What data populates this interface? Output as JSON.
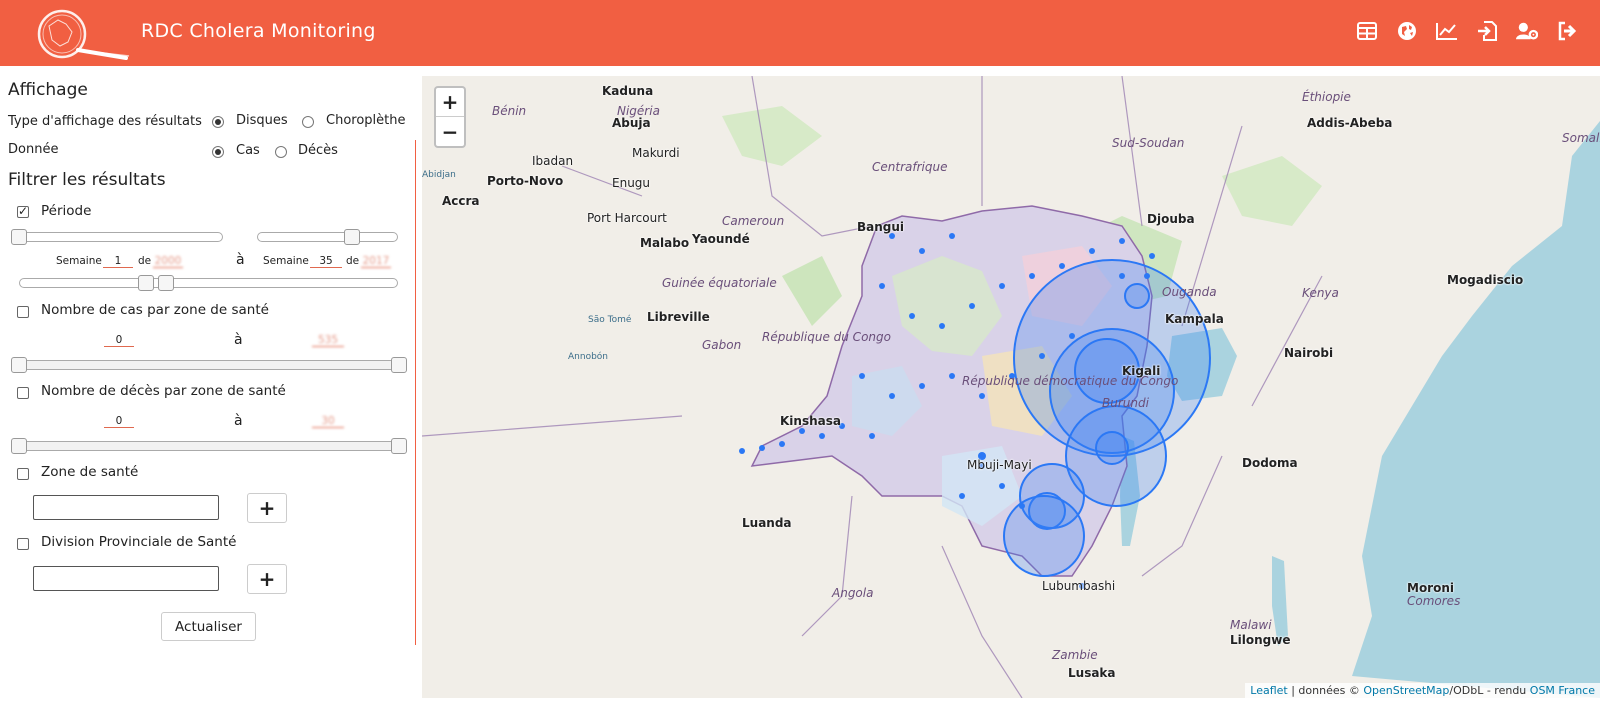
{
  "header": {
    "title": "RDC Cholera Monitoring",
    "icons": [
      "table-icon",
      "globe-icon",
      "chart-line-icon",
      "file-import-icon",
      "user-cog-icon",
      "sign-out-icon"
    ],
    "background": "#f15f42"
  },
  "sidebar": {
    "display_title": "Affichage",
    "display_type_label": "Type d'affichage des résultats",
    "display_type_options": [
      "Disques",
      "Choroplèthe"
    ],
    "display_type_selected": "Disques",
    "data_label": "Donnée",
    "data_options": [
      "Cas",
      "Décès"
    ],
    "data_selected": "Cas",
    "filter_title": "Filtrer les résultats",
    "period": {
      "label": "Période",
      "checked": true,
      "week_label": "Semaine",
      "of_label": "de",
      "to_label": "à",
      "start_week": "1",
      "start_year": "2000",
      "end_week": "35",
      "end_year": "2017"
    },
    "cases": {
      "label": "Nombre de cas par zone de santé",
      "checked": false,
      "min": "0",
      "to_label": "à",
      "max": "535"
    },
    "deaths": {
      "label": "Nombre de décès par zone de santé",
      "checked": false,
      "min": "0",
      "to_label": "à",
      "max": "30"
    },
    "health_zone": {
      "label": "Zone de santé",
      "checked": false,
      "value": "",
      "add_label": "+"
    },
    "division": {
      "label": "Division Provinciale de Santé",
      "checked": false,
      "value": "",
      "add_label": "+"
    },
    "update_label": "Actualiser"
  },
  "map": {
    "zoom_in": "+",
    "zoom_out": "−",
    "attribution": {
      "leaflet": "Leaflet",
      "text1": " | données © ",
      "osm": "OpenStreetMap",
      "text2": "/ODbL - rendu ",
      "osm_fr": "OSM France"
    },
    "cities": [
      "Kaduna",
      "Abuja",
      "Makurdi",
      "Ibadan",
      "Porto-Novo",
      "Accra",
      "Enugu",
      "Port Harcourt",
      "Malabo",
      "Yaoundé",
      "Bangui",
      "Libreville",
      "Kinshasa",
      "Luanda",
      "Mbuji-Mayi",
      "Kigali",
      "Kampala",
      "Nairobi",
      "Djouba",
      "Addis-Abeba",
      "Mogadiscio",
      "Dodoma",
      "Moroni",
      "Lilongwe",
      "Lusaka",
      "Lubumbashi"
    ],
    "regions": [
      "Nigéria",
      "Bénin",
      "Cameroun",
      "Centrafrique",
      "Sud-Soudan",
      "Éthiopie",
      "Gabon",
      "Guinée équatoriale",
      "République du Congo",
      "République démocratique du Congo",
      "Ouganda",
      "Kenya",
      "Burundi",
      "Angola",
      "Zambie",
      "Malawi",
      "Comores",
      "Somalia"
    ],
    "water": [
      "Abidjan",
      "São Tomé",
      "Annobón"
    ]
  }
}
